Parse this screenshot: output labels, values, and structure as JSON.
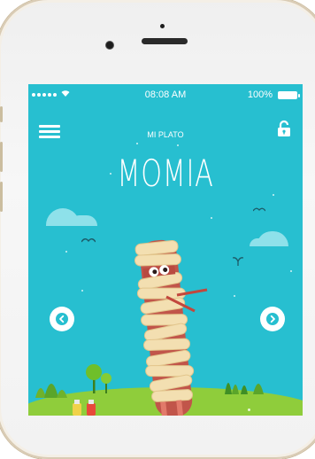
{
  "status_bar": {
    "time": "08:08 AM",
    "battery": "100%"
  },
  "header": {
    "label": "MI PLATO"
  },
  "character": {
    "name": "MOMIA"
  },
  "icons": {
    "menu": "hamburger-menu-icon",
    "lock": "unlock-icon",
    "prev": "chevron-left-icon",
    "next": "chevron-right-icon"
  },
  "colors": {
    "sky": "#27bfd0",
    "ground": "#8fcd3b",
    "arrow": "#27bfd0"
  }
}
